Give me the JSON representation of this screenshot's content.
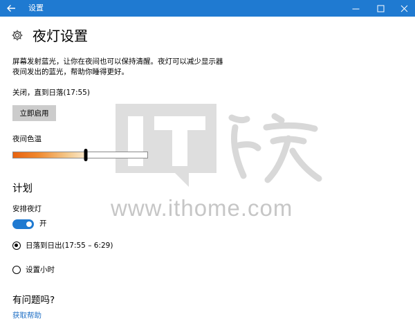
{
  "window": {
    "title": "设置",
    "accent": "#1f7ad1"
  },
  "header": {
    "icon": "gear-icon",
    "title": "夜灯设置"
  },
  "description": {
    "line1": "屏幕发射蓝光，让你在夜间也可以保持清醒。夜灯可以减少显示器",
    "line2": "夜间发出的蓝光，帮助你睡得更好。"
  },
  "status": "关闭，直到日落(17:55)",
  "enable_button": "立即启用",
  "color_temperature": {
    "label": "夜间色温",
    "value_fraction": 0.54
  },
  "schedule": {
    "heading": "计划",
    "toggle_label": "安排夜灯",
    "toggle_on": true,
    "toggle_state": "开",
    "options": [
      {
        "label": "日落到日出(17:55 – 6:29)",
        "checked": true
      },
      {
        "label": "设置小时",
        "checked": false
      }
    ]
  },
  "help": {
    "heading": "有问题吗?",
    "link": "获取帮助",
    "link_color": "#1f6fc5"
  },
  "watermark": {
    "text": "www.ithome.com"
  }
}
